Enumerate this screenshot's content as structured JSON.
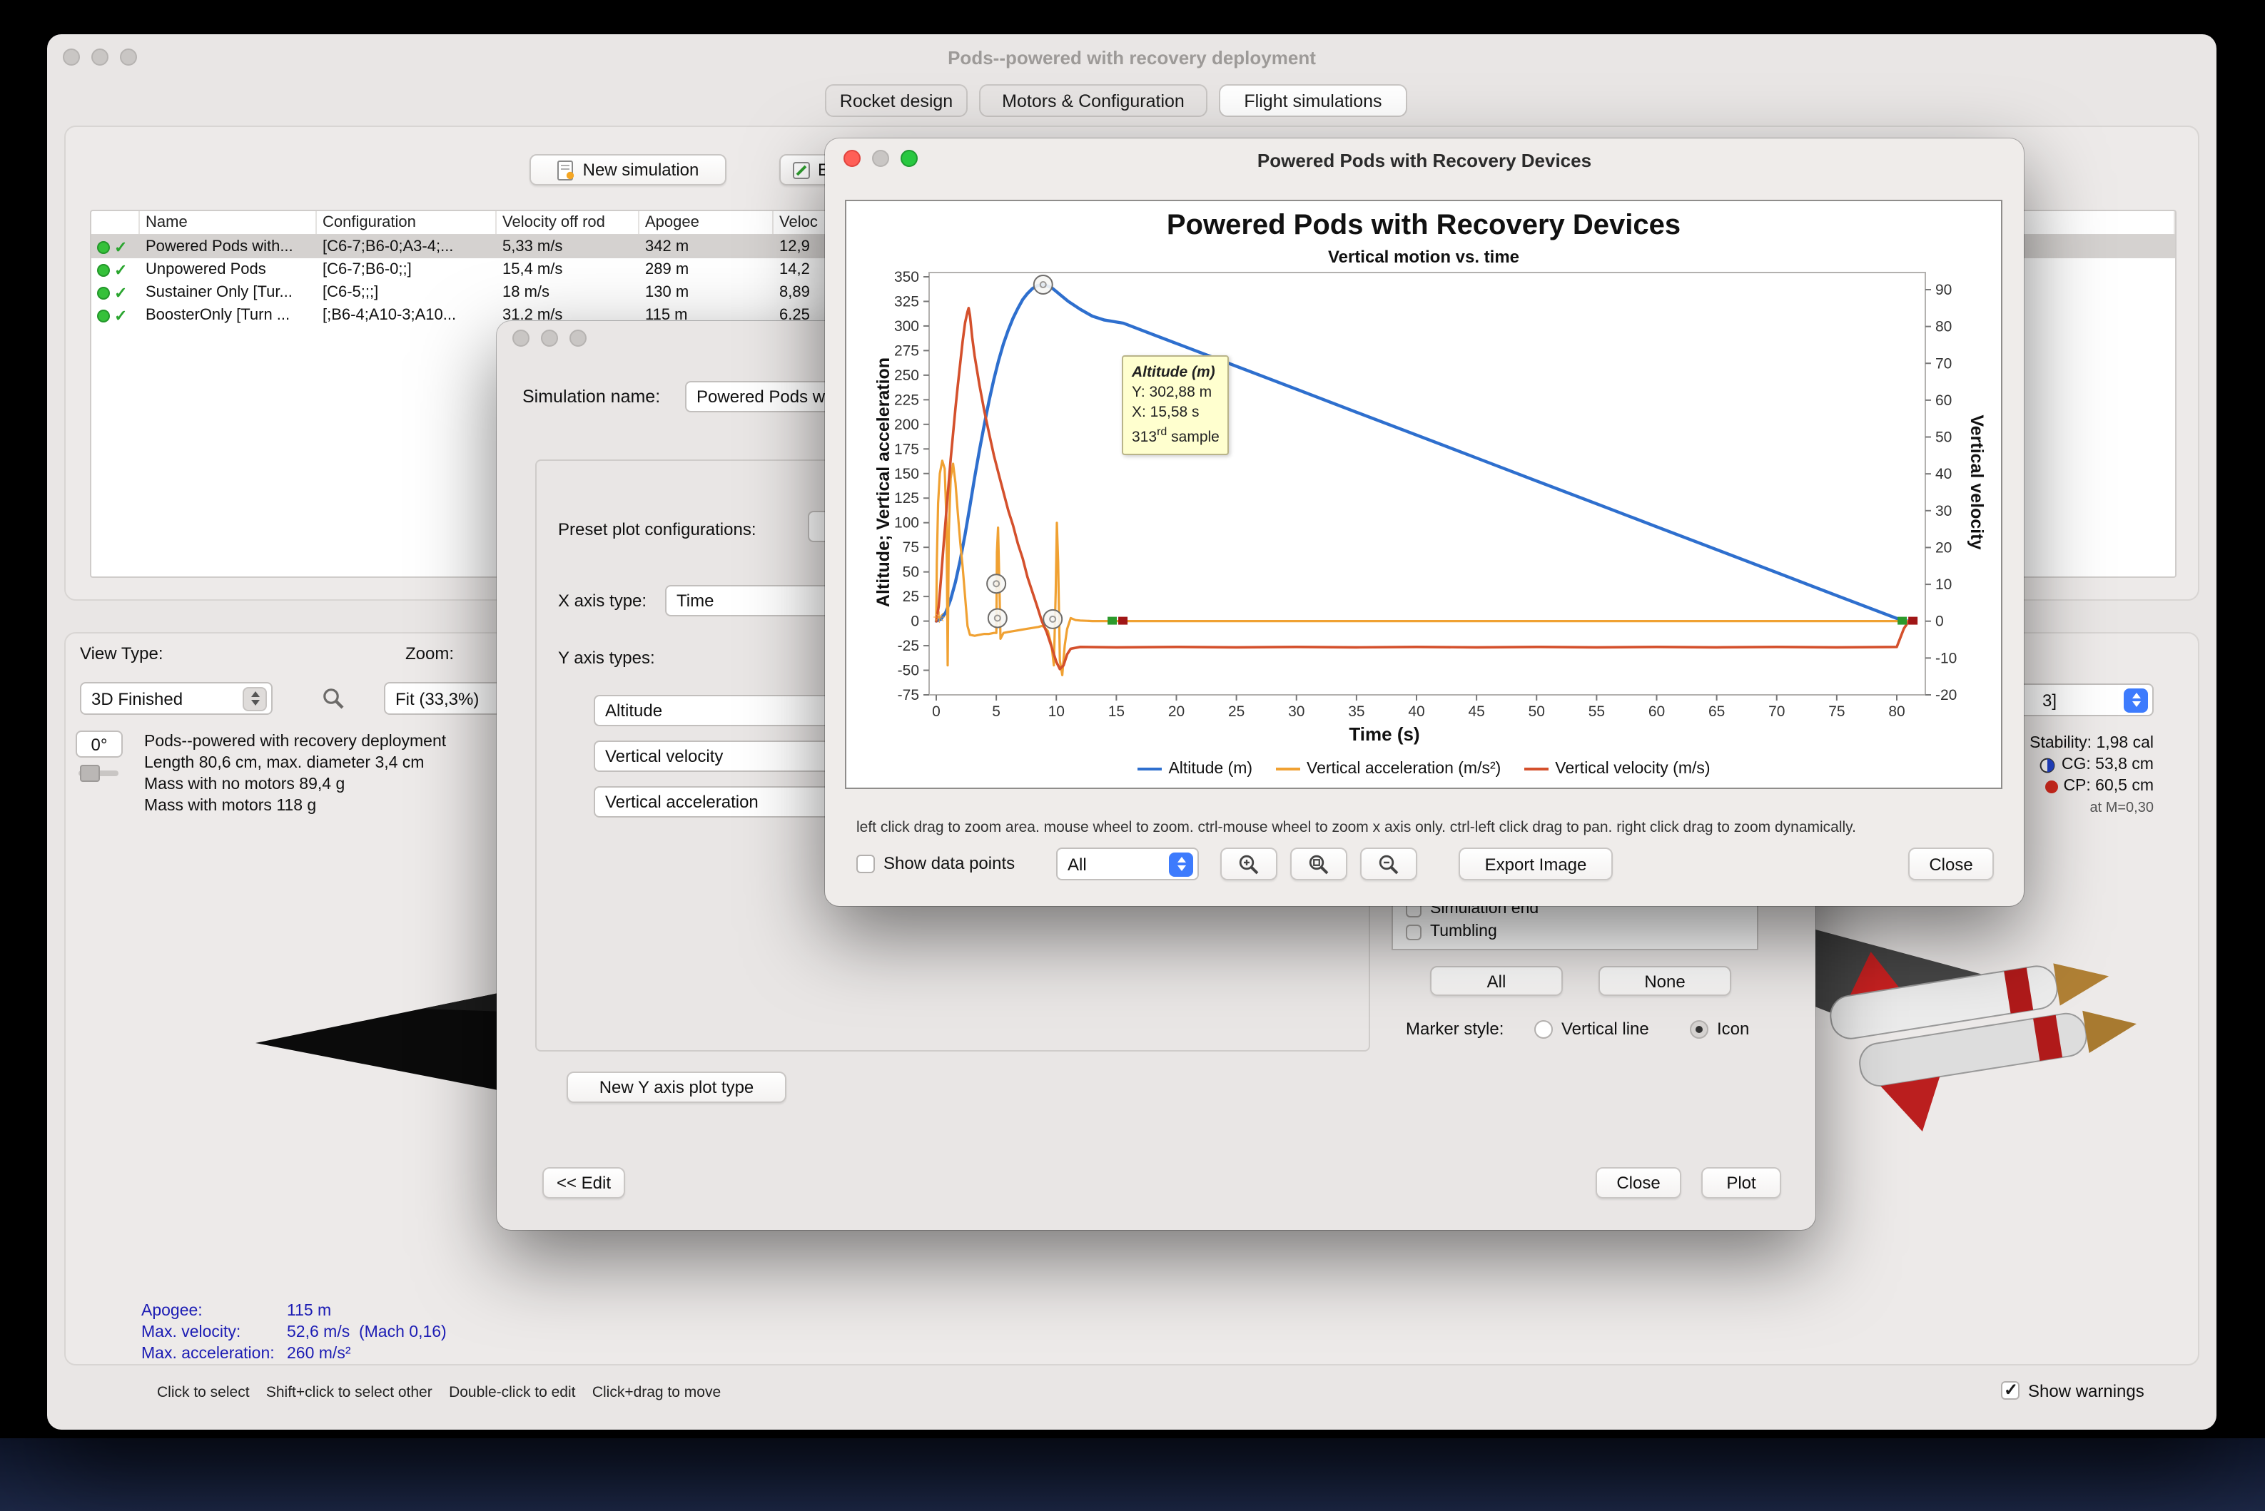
{
  "app": {
    "title": "Pods--powered with recovery deployment",
    "tabs": [
      "Rocket design",
      "Motors & Configuration",
      "Flight simulations"
    ]
  },
  "toolbar": {
    "new_simulation": "New simulation",
    "edit_partial": "E"
  },
  "sim_table": {
    "columns": [
      "Name",
      "Configuration",
      "Velocity off rod",
      "Apogee",
      "Veloc"
    ],
    "rows": [
      {
        "name": "Powered Pods with...",
        "config": "[C6-7;B6-0;A3-4;...",
        "velocity_off_rod": "5,33 m/s",
        "apogee": "342 m",
        "velocity": "12,9"
      },
      {
        "name": "Unpowered Pods",
        "config": "[C6-7;B6-0;;]",
        "velocity_off_rod": "15,4 m/s",
        "apogee": "289 m",
        "velocity": "14,2"
      },
      {
        "name": "Sustainer Only [Tur...",
        "config": "[C6-5;;;]",
        "velocity_off_rod": "18 m/s",
        "apogee": "130 m",
        "velocity": "8,89"
      },
      {
        "name": "BoosterOnly [Turn ...",
        "config": "[;B6-4;A10-3;A10...",
        "velocity_off_rod": "31.2 m/s",
        "apogee": "115 m",
        "velocity": "6.25"
      }
    ]
  },
  "view_controls": {
    "view_type_label": "View Type:",
    "view_type_value": "3D Finished",
    "zoom_label": "Zoom:",
    "zoom_value": "Fit (33,3%)",
    "rotation": "0°"
  },
  "rocket_info": {
    "line1": "Pods--powered with recovery deployment",
    "line2": "Length 80,6 cm, max. diameter 3,4 cm",
    "line3": "Mass with no motors 89,4 g",
    "line4": "Mass with motors 118 g"
  },
  "flight_stats": {
    "apogee_label": "Apogee:",
    "apogee": "115 m",
    "maxv_label": "Max. velocity:",
    "maxv": "52,6 m/s  (Mach 0,16)",
    "maxa_label": "Max. acceleration:",
    "maxa": "260 m/s²"
  },
  "stability": {
    "stability": "Stability: 1,98 cal",
    "cg": "CG: 53,8 cm",
    "cp": "CP: 60,5 cm",
    "mach": "at M=0,30",
    "config_fragment": "3]"
  },
  "statusbar": {
    "hints": "Click to select    Shift+click to select other    Double-click to edit    Click+drag to move",
    "show_warnings": "Show warnings"
  },
  "edit_dialog": {
    "sim_name_label": "Simulation name:",
    "sim_name_value": "Powered Pods with Recovery Devices",
    "preset_label": "Preset plot configurations:",
    "x_axis_label": "X axis type:",
    "x_axis_value": "Time",
    "y_axis_label": "Y axis types:",
    "y_types": [
      "Altitude",
      "Vertical velocity",
      "Vertical acceleration"
    ],
    "new_y_button": "New Y axis plot type",
    "edit_button": "<< Edit",
    "close_button": "Close",
    "plot_button": "Plot",
    "events": [
      "Simulation end",
      "Tumbling"
    ],
    "all_button": "All",
    "none_button": "None",
    "marker_label": "Marker style:",
    "marker_options": [
      "Vertical line",
      "Icon"
    ],
    "marker_selected": "Icon"
  },
  "plot_dialog": {
    "title": "Powered Pods with Recovery Devices",
    "help": "left click drag to zoom area. mouse wheel to zoom. ctrl-mouse wheel to zoom x axis only. ctrl-left click drag to pan.  right click drag to zoom dynamically.",
    "show_data_points": "Show data points",
    "branch_value": "All",
    "export": "Export Image",
    "close": "Close"
  },
  "chart_data": {
    "type": "line",
    "title": "Powered Pods with Recovery Devices",
    "subtitle": "Vertical motion vs. time",
    "xlabel": "Time (s)",
    "ylabel_left": "Altitude; Vertical acceleration",
    "ylabel_right": "Vertical velocity",
    "xlim": [
      0,
      80
    ],
    "xtick_step": 5,
    "ylim_left": [
      -75,
      350
    ],
    "ytick_step_left": 25,
    "ylim_right": [
      -20,
      90
    ],
    "ytick_step_right": 10,
    "grid": false,
    "legend_position": "bottom",
    "legend": [
      {
        "label": "Altitude (m)",
        "color": "#2e6fce"
      },
      {
        "label": "Vertical acceleration (m/s²)",
        "color": "#f0a132"
      },
      {
        "label": "Vertical velocity (m/s)",
        "color": "#d4502c"
      }
    ],
    "series": [
      {
        "name": "Altitude (m)",
        "axis": "left",
        "color": "#2e6fce",
        "width": 2.2,
        "points": [
          [
            0,
            0
          ],
          [
            0.4,
            2
          ],
          [
            0.8,
            9
          ],
          [
            1.2,
            22
          ],
          [
            1.6,
            40
          ],
          [
            2,
            62
          ],
          [
            2.4,
            88
          ],
          [
            2.8,
            117
          ],
          [
            3.2,
            146
          ],
          [
            3.6,
            174
          ],
          [
            4,
            200
          ],
          [
            4.4,
            224
          ],
          [
            4.8,
            246
          ],
          [
            5.2,
            265
          ],
          [
            5.6,
            282
          ],
          [
            6,
            296
          ],
          [
            6.4,
            308
          ],
          [
            6.8,
            318
          ],
          [
            7.2,
            327
          ],
          [
            7.6,
            333
          ],
          [
            8,
            338
          ],
          [
            8.4,
            341
          ],
          [
            8.8,
            342
          ],
          [
            9.2,
            341
          ],
          [
            9.6,
            339
          ],
          [
            10,
            335
          ],
          [
            10.5,
            330
          ],
          [
            11,
            325
          ],
          [
            12,
            317
          ],
          [
            13,
            310
          ],
          [
            14,
            306
          ],
          [
            15.58,
            302.9
          ],
          [
            18,
            291.6
          ],
          [
            20,
            282.3
          ],
          [
            25,
            259
          ],
          [
            30,
            235.7
          ],
          [
            35,
            212.4
          ],
          [
            40,
            189.1
          ],
          [
            45,
            165.8
          ],
          [
            50,
            142.5
          ],
          [
            55,
            119.2
          ],
          [
            60,
            95.9
          ],
          [
            65,
            72.6
          ],
          [
            70,
            49.3
          ],
          [
            75,
            26
          ],
          [
            80,
            2.8
          ],
          [
            80.6,
            0
          ],
          [
            81.4,
            0
          ]
        ]
      },
      {
        "name": "Vertical acceleration (m/s²)",
        "axis": "left",
        "color": "#f0a132",
        "width": 1.6,
        "points": [
          [
            0,
            0
          ],
          [
            0.05,
            60
          ],
          [
            0.15,
            120
          ],
          [
            0.3,
            150
          ],
          [
            0.5,
            163
          ],
          [
            0.7,
            155
          ],
          [
            0.85,
            100
          ],
          [
            0.95,
            -45
          ],
          [
            1.05,
            90
          ],
          [
            1.2,
            145
          ],
          [
            1.4,
            160
          ],
          [
            1.6,
            140
          ],
          [
            1.8,
            110
          ],
          [
            2,
            80
          ],
          [
            2.2,
            55
          ],
          [
            2.4,
            25
          ],
          [
            2.6,
            -5
          ],
          [
            2.8,
            -14
          ],
          [
            3.2,
            -15
          ],
          [
            3.6,
            -14
          ],
          [
            4,
            -13
          ],
          [
            4.4,
            -13
          ],
          [
            4.8,
            -12
          ],
          [
            5,
            -12
          ],
          [
            5.05,
            70
          ],
          [
            5.15,
            95
          ],
          [
            5.25,
            40
          ],
          [
            5.35,
            -18
          ],
          [
            5.6,
            -12
          ],
          [
            6,
            -11
          ],
          [
            6.5,
            -10
          ],
          [
            7,
            -9
          ],
          [
            7.5,
            -8
          ],
          [
            8,
            -7
          ],
          [
            8.5,
            -6
          ],
          [
            8.8,
            -5
          ],
          [
            9,
            -6
          ],
          [
            9.3,
            -10
          ],
          [
            9.6,
            -25
          ],
          [
            9.8,
            -45
          ],
          [
            9.95,
            30
          ],
          [
            10.05,
            100
          ],
          [
            10.15,
            60
          ],
          [
            10.3,
            -40
          ],
          [
            10.5,
            -55
          ],
          [
            10.7,
            -25
          ],
          [
            10.9,
            -8
          ],
          [
            11.2,
            3
          ],
          [
            11.6,
            1
          ],
          [
            12,
            0.5
          ],
          [
            13,
            0
          ],
          [
            15,
            0
          ],
          [
            20,
            0
          ],
          [
            30,
            0
          ],
          [
            40,
            0
          ],
          [
            50,
            0
          ],
          [
            60,
            0
          ],
          [
            70,
            0
          ],
          [
            80,
            0
          ],
          [
            81.4,
            0
          ]
        ]
      },
      {
        "name": "Vertical velocity (m/s)",
        "axis": "right",
        "color": "#d4502c",
        "width": 1.8,
        "points": [
          [
            0,
            0
          ],
          [
            0.2,
            4
          ],
          [
            0.4,
            12
          ],
          [
            0.6,
            20
          ],
          [
            0.8,
            28
          ],
          [
            1,
            36
          ],
          [
            1.2,
            44
          ],
          [
            1.4,
            51
          ],
          [
            1.6,
            58
          ],
          [
            1.8,
            64
          ],
          [
            2,
            70
          ],
          [
            2.2,
            76
          ],
          [
            2.4,
            81
          ],
          [
            2.6,
            84
          ],
          [
            2.7,
            85
          ],
          [
            2.8,
            83
          ],
          [
            3,
            77
          ],
          [
            3.2,
            72
          ],
          [
            3.6,
            64
          ],
          [
            4,
            57
          ],
          [
            4.4,
            51
          ],
          [
            4.8,
            45
          ],
          [
            5.2,
            40
          ],
          [
            5.6,
            35
          ],
          [
            6,
            30
          ],
          [
            6.4,
            26
          ],
          [
            6.8,
            21
          ],
          [
            7.2,
            17
          ],
          [
            7.6,
            12
          ],
          [
            8,
            8
          ],
          [
            8.4,
            4
          ],
          [
            8.8,
            0
          ],
          [
            9.2,
            -3
          ],
          [
            9.6,
            -7
          ],
          [
            10,
            -11
          ],
          [
            10.3,
            -13
          ],
          [
            10.6,
            -12
          ],
          [
            10.9,
            -9
          ],
          [
            11.2,
            -7.5
          ],
          [
            12,
            -7
          ],
          [
            15,
            -7.1
          ],
          [
            20,
            -7
          ],
          [
            25,
            -7.1
          ],
          [
            30,
            -7
          ],
          [
            35,
            -7.1
          ],
          [
            40,
            -7
          ],
          [
            45,
            -7.1
          ],
          [
            50,
            -7
          ],
          [
            55,
            -7.1
          ],
          [
            60,
            -7
          ],
          [
            65,
            -7.1
          ],
          [
            70,
            -7
          ],
          [
            75,
            -7.1
          ],
          [
            80,
            -7
          ],
          [
            80.6,
            -2
          ],
          [
            81,
            0
          ]
        ]
      }
    ],
    "markers": [
      {
        "type": "star",
        "t": 0.3,
        "v": 4
      },
      {
        "type": "circle",
        "t": 5,
        "v": 38
      },
      {
        "type": "circle",
        "t": 5.1,
        "v": 3
      },
      {
        "type": "circle",
        "t": 8.9,
        "v": 342
      },
      {
        "type": "circle",
        "t": 9.7,
        "v": 2
      },
      {
        "type": "flag",
        "t": 15.1,
        "v": 0
      },
      {
        "type": "flag",
        "t": 80.9,
        "v": 0
      }
    ],
    "annotation": {
      "label": "Altitude (m)",
      "y_text": "Y: 302,88 m",
      "x_text": "X: 15,58 s",
      "sample_number": "313",
      "sample_suffix": "rd",
      "sample_word": " sample"
    }
  }
}
